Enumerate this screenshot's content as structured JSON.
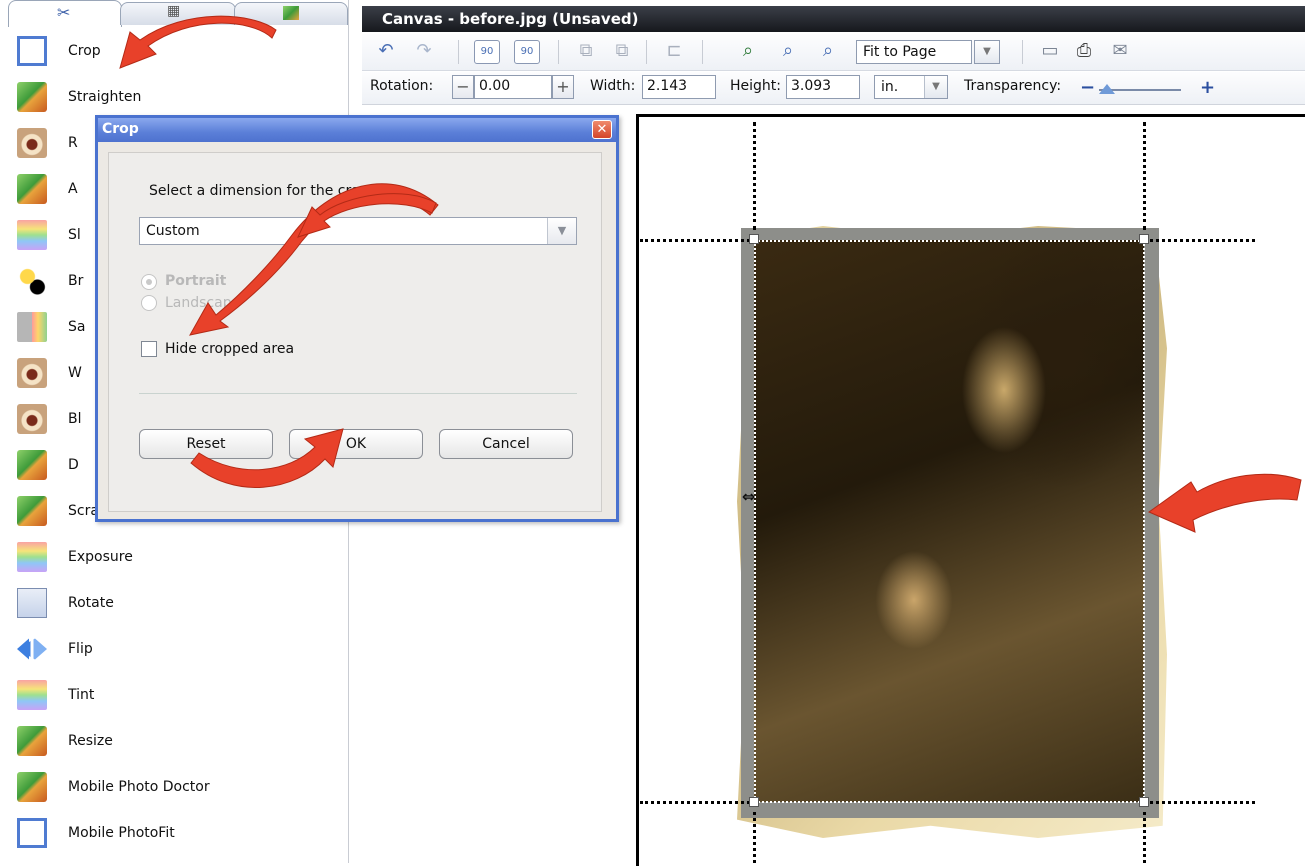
{
  "left_panel": {
    "tools": [
      {
        "label": "Crop",
        "icon": "crop-icon"
      },
      {
        "label": "Straighten",
        "icon": "straighten-icon"
      },
      {
        "label": "R",
        "icon": "red-eye-icon"
      },
      {
        "label": "A",
        "icon": "photo-icon"
      },
      {
        "label": "Sl",
        "icon": "rainbow-icon"
      },
      {
        "label": "Br",
        "icon": "brightness-icon"
      },
      {
        "label": "Sa",
        "icon": "saturation-icon"
      },
      {
        "label": "W",
        "icon": "eye-icon"
      },
      {
        "label": "Bl",
        "icon": "eye-icon"
      },
      {
        "label": "D",
        "icon": "photo-icon"
      },
      {
        "label": "Scratches",
        "icon": "photo-icon"
      },
      {
        "label": "Exposure",
        "icon": "rainbow-icon"
      },
      {
        "label": "Rotate",
        "icon": "rotate-icon"
      },
      {
        "label": "Flip",
        "icon": "flip-icon"
      },
      {
        "label": "Tint",
        "icon": "rainbow-icon"
      },
      {
        "label": "Resize",
        "icon": "resize-icon"
      },
      {
        "label": "Mobile Photo Doctor",
        "icon": "photo-icon"
      },
      {
        "label": "Mobile PhotoFit",
        "icon": "crop-icon"
      }
    ]
  },
  "canvas_window": {
    "title": "Canvas - before.jpg (Unsaved)"
  },
  "toolbar": {
    "zoom_select": "Fit to Page",
    "rotate_left_label": "90",
    "rotate_right_label": "90"
  },
  "properties": {
    "rotation_label": "Rotation:",
    "rotation_value": "0.00",
    "width_label": "Width:",
    "width_value": "2.143",
    "height_label": "Height:",
    "height_value": "3.093",
    "unit": "in.",
    "transparency_label": "Transparency:",
    "transparency_level": 0.1
  },
  "crop_dialog": {
    "title": "Crop",
    "close_label": "✕",
    "prompt": "Select a dimension for the crop",
    "dimension_value": "Custom",
    "portrait_label": "Portrait",
    "landscape_label": "Landscape",
    "hide_cropped_label": "Hide cropped area",
    "reset_label": "Reset",
    "ok_label": "OK",
    "cancel_label": "Cancel"
  },
  "colors": {
    "accent": "#4a72cf",
    "annotation_arrow": "#e8412a",
    "title_bar": "#1f2228"
  }
}
